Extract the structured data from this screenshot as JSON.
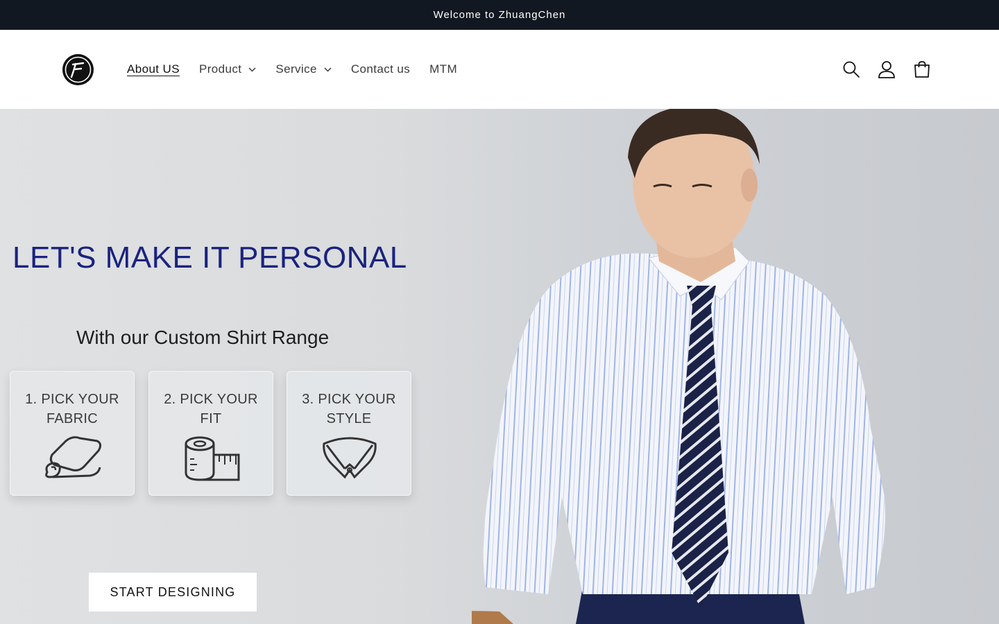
{
  "announcement": {
    "text": "Welcome to ZhuangChen"
  },
  "header": {
    "logo_name": "zhuangchen-logo",
    "nav": [
      {
        "label": "About US",
        "dropdown": false,
        "active": true
      },
      {
        "label": "Product",
        "dropdown": true,
        "active": false
      },
      {
        "label": "Service",
        "dropdown": true,
        "active": false
      },
      {
        "label": "Contact us",
        "dropdown": false,
        "active": false
      },
      {
        "label": "MTM",
        "dropdown": false,
        "active": false
      }
    ],
    "icons": [
      "search-icon",
      "account-icon",
      "cart-icon"
    ]
  },
  "hero": {
    "title": "LET'S MAKE IT PERSONAL",
    "subtitle": "With our Custom Shirt Range",
    "steps": [
      {
        "label": "1. PICK YOUR FABRIC",
        "icon": "fabric-roll-icon"
      },
      {
        "label": "2. PICK YOUR FIT",
        "icon": "measuring-tape-icon"
      },
      {
        "label": "3. PICK YOUR STYLE",
        "icon": "shirt-collar-icon"
      }
    ],
    "cta_label": "START DESIGNING"
  },
  "colors": {
    "announcement_bg": "#121822",
    "title_color": "#1a237e",
    "tie_color": "#1b2247",
    "stripe_color": "#9fb4e6"
  }
}
